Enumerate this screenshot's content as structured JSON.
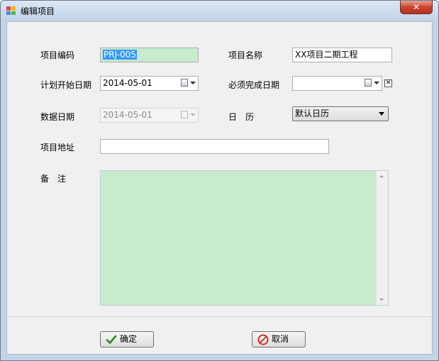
{
  "window": {
    "title": "编辑项目",
    "close_glyph": "✕",
    "accent_color": "#c7ebcc"
  },
  "form": {
    "project_code": {
      "label": "项目编码",
      "value": "PRJ-005"
    },
    "project_name": {
      "label": "项目名称",
      "value": "XX项目二期工程"
    },
    "plan_start_date": {
      "label": "计划开始日期",
      "value": "2014-05-01",
      "icon": "calendar-dropdown-icon"
    },
    "required_finish_date": {
      "label": "必须完成日期",
      "value": "",
      "clear_glyph": "✕"
    },
    "data_date": {
      "label": "数据日期",
      "value": "2014-05-01"
    },
    "calendar": {
      "label": "日　历",
      "selected": "默认日历"
    },
    "project_address": {
      "label": "项目地址",
      "value": ""
    },
    "remarks": {
      "label": "备　注",
      "value": ""
    }
  },
  "buttons": {
    "ok": {
      "label": "确定",
      "icon": "checkmark-icon"
    },
    "cancel": {
      "label": "取消",
      "icon": "cancel-icon"
    }
  }
}
